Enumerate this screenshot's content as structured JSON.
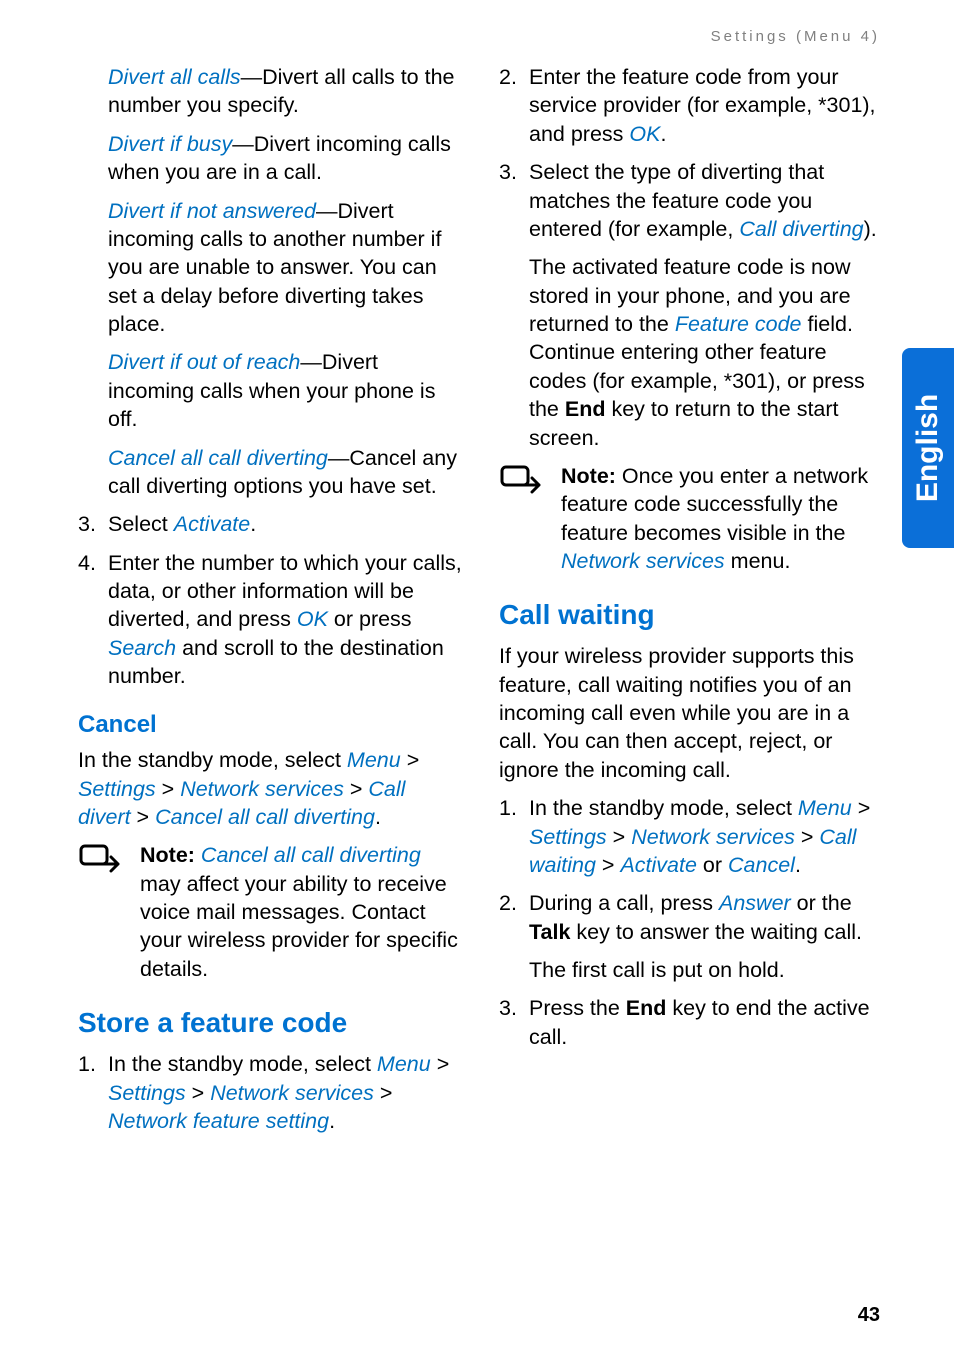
{
  "runningHead": "Settings (Menu 4)",
  "sideTab": "English",
  "pageNumber": "43",
  "left": {
    "divertAll": {
      "term": "Divert all calls",
      "rest": "—Divert all calls to the number you specify."
    },
    "divertBusy": {
      "term": "Divert if busy",
      "rest": "—Divert incoming calls when you are in a call."
    },
    "divertNoAns": {
      "term": "Divert if not answered",
      "rest": "—Divert incoming calls to another number if you are unable to answer. You can set a delay before diverting takes place."
    },
    "divertOOR": {
      "term": "Divert if out of reach",
      "rest": "—Divert incoming calls when your phone is off."
    },
    "cancelAll": {
      "term": "Cancel all call diverting",
      "rest": "—Cancel any call diverting options you have set."
    },
    "step3": {
      "num": "3.",
      "a": "Select ",
      "b": "Activate",
      "c": "."
    },
    "step4": {
      "num": "4.",
      "a": "Enter the number to which your calls, data, or other information will be diverted, and press ",
      "ok": "OK",
      "b": " or press ",
      "search": "Search",
      "c": " and scroll to the destination number."
    },
    "cancelHeading": "Cancel",
    "cancelPara": {
      "a": "In the standby mode, select ",
      "menu": "Menu",
      "gt1": " > ",
      "settings": "Settings",
      "gt2": " > ",
      "ns": "Network services",
      "gt3": " > ",
      "cd": "Call divert",
      "gt4": " > ",
      "cacd": "Cancel all call diverting",
      "dot": "."
    },
    "cancelNote": {
      "label": "Note:",
      "term": " Cancel all call diverting",
      "rest": " may affect your ability to receive voice mail messages. Contact your wireless provider for specific details."
    },
    "storeHeading": "Store a feature code",
    "store1": {
      "num": "1.",
      "a": "In the standby mode, select ",
      "menu": "Menu",
      "gt1": " > ",
      "settings": "Settings",
      "gt2": " > ",
      "ns": "Network services",
      "gt3": " > ",
      "nfs": "Network feature setting",
      "dot": "."
    }
  },
  "right": {
    "step2": {
      "num": "2.",
      "a": "Enter the feature code from your service provider (for example, *301), and press ",
      "ok": "OK",
      "dot": "."
    },
    "step3": {
      "num": "3.",
      "a": "Select the type of diverting that matches the feature code you entered (for example, ",
      "cd": "Call diverting",
      "b": ")."
    },
    "step3b": {
      "a": "The activated feature code is now stored in your phone, and you are returned to the ",
      "fc": "Feature code",
      "b": " field. Continue entering other feature codes (for example, *301), or press the ",
      "end": "End",
      "c": " key to return to the start screen."
    },
    "note": {
      "label": "Note:",
      "a": " Once you enter a network feature code successfully the feature becomes visible in the ",
      "ns": "Network services",
      "b": " menu."
    },
    "cwHeading": "Call waiting",
    "cwPara": "If your wireless provider supports this feature, call waiting notifies you of an incoming call even while you are in a call. You can then accept, reject, or ignore the incoming call.",
    "cw1": {
      "num": "1.",
      "a": "In the standby mode, select ",
      "menu": "Menu",
      "gt1": " > ",
      "settings": "Settings",
      "gt2": " > ",
      "ns": "Network services",
      "gt3": " > ",
      "cw": "Call waiting",
      "gt4": " > ",
      "act": "Activate",
      "or": " or ",
      "can": "Cancel",
      "dot": "."
    },
    "cw2": {
      "num": "2.",
      "a": "During a call, press ",
      "ans": "Answer",
      "b": " or the ",
      "talk": "Talk",
      "c": " key to answer the waiting call."
    },
    "cw2b": "The first call is put on hold.",
    "cw3": {
      "num": "3.",
      "a": "Press the ",
      "end": "End",
      "b": " key to end the active call."
    }
  }
}
